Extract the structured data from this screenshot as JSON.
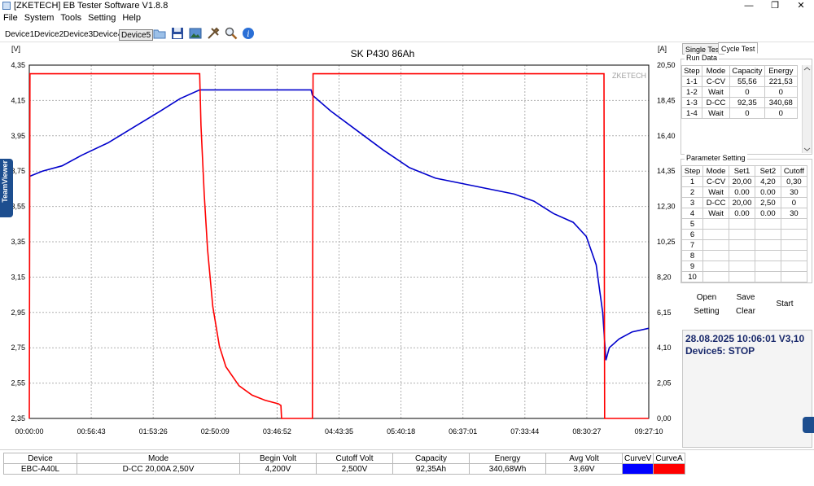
{
  "window": {
    "title": "[ZKETECH] EB Tester Software V1.8.8",
    "minimize_glyph": "—",
    "restore_glyph": "❐",
    "close_glyph": "✕"
  },
  "menu": [
    "File",
    "System",
    "Tools",
    "Setting",
    "Help"
  ],
  "devices": [
    "Device1",
    "Device2",
    "Device3",
    "Device4",
    "Device5"
  ],
  "active_device": "Device5",
  "toolbar_icons": [
    "folder-icon",
    "save-icon",
    "image-icon",
    "tools-icon",
    "magnifier-icon",
    "info-icon"
  ],
  "teamviewer_label": "TeamViewer",
  "chart_data": {
    "type": "line",
    "title": "SK P430 86Ah",
    "watermark": "ZKETECH",
    "y_left_unit": "[V]",
    "y_right_unit": "[A]",
    "y_left_ticks": [
      "4,35",
      "4,15",
      "3,95",
      "3,75",
      "3,55",
      "3,35",
      "3,15",
      "2,95",
      "2,75",
      "2,55",
      "2,35"
    ],
    "y_left_range": [
      2.35,
      4.35
    ],
    "y_right_ticks": [
      "20,50",
      "18,45",
      "16,40",
      "14,35",
      "12,30",
      "10,25",
      "8,20",
      "6,15",
      "4,10",
      "2,05",
      "0,00"
    ],
    "y_right_range": [
      0,
      20.5
    ],
    "x_ticks": [
      "00:00:00",
      "00:56:43",
      "01:53:26",
      "02:50:09",
      "03:46:52",
      "04:43:35",
      "05:40:18",
      "06:37:01",
      "07:33:44",
      "08:30:27",
      "09:27:10"
    ],
    "x_range_hours": [
      0,
      9.453
    ],
    "grid": true,
    "series": [
      {
        "name": "CurveV",
        "color": "#0000cc",
        "axis": "left",
        "points": [
          [
            0,
            3.72
          ],
          [
            0.2,
            3.75
          ],
          [
            0.5,
            3.78
          ],
          [
            0.8,
            3.84
          ],
          [
            1.2,
            3.91
          ],
          [
            1.6,
            4.0
          ],
          [
            2.0,
            4.09
          ],
          [
            2.3,
            4.16
          ],
          [
            2.6,
            4.21
          ],
          [
            2.65,
            4.21
          ],
          [
            3.0,
            4.21
          ],
          [
            3.5,
            4.21
          ],
          [
            4.0,
            4.21
          ],
          [
            4.3,
            4.21
          ],
          [
            4.32,
            4.18
          ],
          [
            4.6,
            4.09
          ],
          [
            5.0,
            3.98
          ],
          [
            5.4,
            3.87
          ],
          [
            5.8,
            3.77
          ],
          [
            6.2,
            3.71
          ],
          [
            6.6,
            3.68
          ],
          [
            7.0,
            3.65
          ],
          [
            7.4,
            3.62
          ],
          [
            7.7,
            3.58
          ],
          [
            8.0,
            3.51
          ],
          [
            8.3,
            3.46
          ],
          [
            8.5,
            3.38
          ],
          [
            8.65,
            3.22
          ],
          [
            8.75,
            2.95
          ],
          [
            8.8,
            2.68
          ],
          [
            8.85,
            2.75
          ],
          [
            9.0,
            2.8
          ],
          [
            9.2,
            2.84
          ],
          [
            9.45,
            2.86
          ]
        ]
      },
      {
        "name": "CurveA",
        "color": "#ff0000",
        "axis": "right",
        "points": [
          [
            0,
            0
          ],
          [
            0.01,
            20.0
          ],
          [
            2.6,
            20.0
          ],
          [
            2.62,
            17.0
          ],
          [
            2.67,
            13.0
          ],
          [
            2.72,
            9.8
          ],
          [
            2.8,
            6.5
          ],
          [
            2.9,
            4.2
          ],
          [
            3.0,
            3.0
          ],
          [
            3.2,
            1.9
          ],
          [
            3.4,
            1.35
          ],
          [
            3.6,
            1.05
          ],
          [
            3.8,
            0.85
          ],
          [
            3.84,
            0.75
          ],
          [
            3.85,
            0
          ],
          [
            4.32,
            0
          ],
          [
            4.33,
            20.0
          ],
          [
            8.77,
            20.0
          ],
          [
            8.78,
            0
          ],
          [
            9.45,
            0
          ]
        ]
      }
    ]
  },
  "right_panel": {
    "tabs": [
      "Single Test",
      "Cycle Test"
    ],
    "active_tab": "Cycle Test",
    "run_data": {
      "label": "Run Data",
      "headers": [
        "Step",
        "Mode",
        "Capacity",
        "Energy"
      ],
      "rows": [
        [
          "1-1",
          "C-CV",
          "55,56",
          "221,53"
        ],
        [
          "1-2",
          "Wait",
          "0",
          "0"
        ],
        [
          "1-3",
          "D-CC",
          "92,35",
          "340,68"
        ],
        [
          "1-4",
          "Wait",
          "0",
          "0"
        ]
      ]
    },
    "parameter_setting": {
      "label": "Parameter Setting",
      "headers": [
        "Step",
        "Mode",
        "Set1",
        "Set2",
        "Cutoff"
      ],
      "rows": [
        [
          "1",
          "C-CV",
          "20,00",
          "4,20",
          "0,30"
        ],
        [
          "2",
          "Wait",
          "0.00",
          "0.00",
          "30"
        ],
        [
          "3",
          "D-CC",
          "20,00",
          "2,50",
          "0"
        ],
        [
          "4",
          "Wait",
          "0.00",
          "0.00",
          "30"
        ],
        [
          "5",
          "",
          "",
          "",
          ""
        ],
        [
          "6",
          "",
          "",
          "",
          ""
        ],
        [
          "7",
          "",
          "",
          "",
          ""
        ],
        [
          "8",
          "",
          "",
          "",
          ""
        ],
        [
          "9",
          "",
          "",
          "",
          ""
        ],
        [
          "10",
          "",
          "",
          "",
          ""
        ]
      ]
    },
    "buttons": {
      "open": "Open",
      "save": "Save",
      "setting": "Setting",
      "clear": "Clear",
      "start": "Start"
    },
    "status": {
      "line1": "28.08.2025 10:06:01  V3,10",
      "line2": "Device5: STOP"
    }
  },
  "summary": {
    "headers": [
      "Device",
      "Mode",
      "Begin Volt",
      "Cutoff Volt",
      "Capacity",
      "Energy",
      "Avg Volt",
      "CurveV",
      "CurveA"
    ],
    "values": [
      "EBC-A40L",
      "D-CC  20,00A  2,50V",
      "4,200V",
      "2,500V",
      "92,35Ah",
      "340,68Wh",
      "3,69V",
      "",
      ""
    ],
    "curve_colors": [
      "#0000ff",
      "#ff0000"
    ]
  }
}
